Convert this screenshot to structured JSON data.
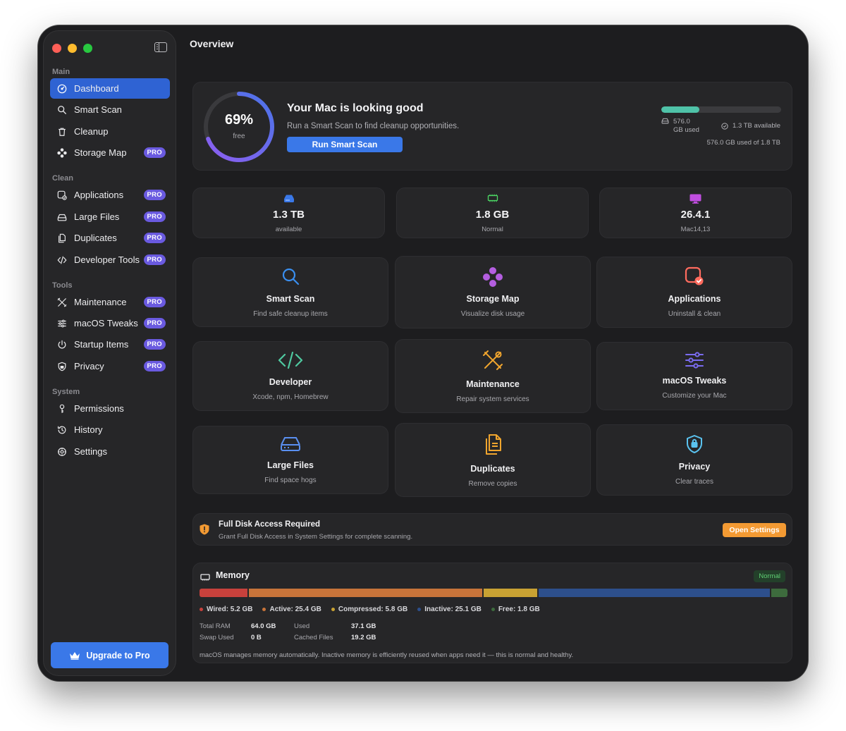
{
  "sidebar": {
    "sections": [
      "Main",
      "Clean",
      "Tools",
      "System"
    ],
    "items": [
      {
        "label": "Dashboard",
        "icon": "dashboard-icon",
        "pro": false,
        "active": true
      },
      {
        "label": "Smart Scan",
        "icon": "search-icon",
        "pro": false
      },
      {
        "label": "Cleanup",
        "icon": "trash-icon",
        "pro": false
      },
      {
        "label": "Storage Map",
        "icon": "storage-map-icon",
        "pro": true
      },
      {
        "label": "Applications",
        "icon": "applications-icon",
        "pro": true
      },
      {
        "label": "Large Files",
        "icon": "drive-icon",
        "pro": true
      },
      {
        "label": "Duplicates",
        "icon": "duplicates-icon",
        "pro": true
      },
      {
        "label": "Developer Tools",
        "icon": "code-icon",
        "pro": true
      },
      {
        "label": "Maintenance",
        "icon": "tools-icon",
        "pro": true
      },
      {
        "label": "macOS Tweaks",
        "icon": "sliders-icon",
        "pro": true
      },
      {
        "label": "Startup Items",
        "icon": "power-icon",
        "pro": true
      },
      {
        "label": "Privacy",
        "icon": "shield-icon",
        "pro": true
      },
      {
        "label": "Permissions",
        "icon": "key-icon",
        "pro": false
      },
      {
        "label": "History",
        "icon": "history-icon",
        "pro": false
      },
      {
        "label": "Settings",
        "icon": "gear-icon",
        "pro": false
      }
    ],
    "pro_label": "PRO",
    "upgrade_label": "Upgrade to Pro"
  },
  "header": {
    "title": "Overview"
  },
  "hero": {
    "ring_percent": 69,
    "ring_percent_label": "69%",
    "ring_label": "free",
    "title": "Your Mac is looking good",
    "subtitle": "Run a Smart Scan to find cleanup opportunities.",
    "button": "Run Smart Scan",
    "disk_fill": 0.32,
    "disk_used_value": "576.0",
    "disk_used_unit": "GB used",
    "disk_available": "1.3 TB available",
    "disk_summary": "576.0 GB used of 1.8 TB"
  },
  "stats": [
    {
      "value": "1.3 TB",
      "label": "available",
      "icon": "drive-icon",
      "color": "#3a78e8"
    },
    {
      "value": "1.8 GB",
      "label": "Normal",
      "icon": "memory-chip-icon",
      "color": "#4cd964"
    },
    {
      "value": "26.4.1",
      "label": "Mac14,13",
      "icon": "display-icon",
      "color": "#c04ee0"
    }
  ],
  "tiles": [
    {
      "title": "Smart Scan",
      "desc": "Find safe cleanup items",
      "icon": "search-icon",
      "color": "#3a8ff0"
    },
    {
      "title": "Storage Map",
      "desc": "Visualize disk usage",
      "icon": "storage-map-icon",
      "color": "#b45ee0"
    },
    {
      "title": "Applications",
      "desc": "Uninstall & clean",
      "icon": "applications-icon",
      "color": "#ff6b5e"
    },
    {
      "title": "Developer",
      "desc": "Xcode, npm, Homebrew",
      "icon": "code-icon",
      "color": "#4fc9a0"
    },
    {
      "title": "Maintenance",
      "desc": "Repair system services",
      "icon": "tools-icon",
      "color": "#f0a52e"
    },
    {
      "title": "macOS Tweaks",
      "desc": "Customize your Mac",
      "icon": "sliders-icon",
      "color": "#7a6cf0"
    },
    {
      "title": "Large Files",
      "desc": "Find space hogs",
      "icon": "drive-icon",
      "color": "#5a8ff0"
    },
    {
      "title": "Duplicates",
      "desc": "Remove copies",
      "icon": "duplicates-icon",
      "color": "#f0a52e"
    },
    {
      "title": "Privacy",
      "desc": "Clear traces",
      "icon": "shield-lock-icon",
      "color": "#5ac3f0"
    }
  ],
  "alert": {
    "title": "Full Disk Access Required",
    "desc": "Grant Full Disk Access in System Settings for complete scanning.",
    "button": "Open Settings",
    "icon": "warning-shield-icon",
    "color": "#f39a33"
  },
  "memory": {
    "title": "Memory",
    "badge": "Normal",
    "segments": [
      {
        "label": "Wired: 5.2 GB",
        "gb": 5.2,
        "color": "#c8413c"
      },
      {
        "label": "Active: 25.4 GB",
        "gb": 25.4,
        "color": "#c8743a"
      },
      {
        "label": "Compressed: 5.8 GB",
        "gb": 5.8,
        "color": "#c9a233"
      },
      {
        "label": "Inactive: 25.1 GB",
        "gb": 25.1,
        "color": "#2d4f8c"
      },
      {
        "label": "Free: 1.8 GB",
        "gb": 1.8,
        "color": "#3d6b3d"
      }
    ],
    "stats": {
      "total_ram_label": "Total RAM",
      "total_ram": "64.0 GB",
      "used_label": "Used",
      "used": "37.1 GB",
      "swap_label": "Swap Used",
      "swap": "0 B",
      "cached_label": "Cached Files",
      "cached": "19.2 GB"
    },
    "note": "macOS manages memory automatically. Inactive memory is efficiently reused when apps need it — this is normal and healthy."
  }
}
